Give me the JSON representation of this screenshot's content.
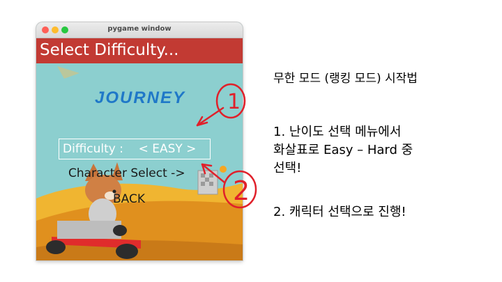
{
  "window": {
    "title": "pygame window"
  },
  "game": {
    "banner": "Select Difficulty...",
    "logo_text": "JOURNEY",
    "difficulty_row": "Difficulty :    < EASY >",
    "character_select": "Character Select ->",
    "back": "BACK"
  },
  "annotations": {
    "marker_1": "1",
    "marker_2": "2",
    "color": "#e0202a"
  },
  "instructions": {
    "title": "무한 모드 (랭킹 모드) 시작법",
    "step1_line1": "1. 난이도 선택 메뉴에서",
    "step1_line2": "화살표로 Easy – Hard 중",
    "step1_line3": "선택!",
    "step2": "2. 캐릭터 선택으로 진행!"
  },
  "colors": {
    "banner": "#c23a33",
    "sky": "#8ccfcf",
    "road": "#e0901e",
    "logo": "#1f78c8"
  }
}
